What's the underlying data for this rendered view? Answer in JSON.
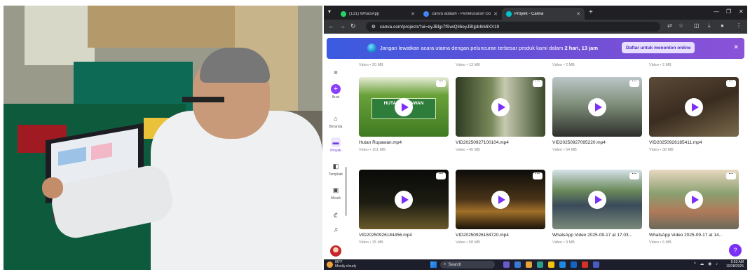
{
  "browser": {
    "tabs": [
      {
        "label": "(131) WhatsApp",
        "color": "#25d366"
      },
      {
        "label": "canva adalah - Penelusuran Go",
        "color": "#4285f4"
      },
      {
        "label": "Proyek - Canva",
        "color": "#00c4cc"
      }
    ],
    "url": "canva.com/projects?ui=eyJBIjp7fSwiQiI6eyJBIjpbIkMiXX19"
  },
  "banner": {
    "text_before": "Jangan lewatkan acara utama dengan peluncuran terbesar produk kami dalam ",
    "countdown": "2 hari, 13 jam",
    "button": "Daftar untuk menonton online",
    "close": "✕"
  },
  "sidebar": {
    "items": [
      {
        "label": "Buat",
        "icon": "plus-icon"
      },
      {
        "label": "Beranda",
        "icon": "home-icon"
      },
      {
        "label": "Proyek",
        "icon": "folder-icon"
      },
      {
        "label": "Template",
        "icon": "template-icon"
      },
      {
        "label": "Merek",
        "icon": "brand-icon"
      }
    ]
  },
  "top_row_meta": [
    "Video • 20 MB",
    "Video • 13 MB",
    "Video • 2 MB",
    "Video • 2 MB"
  ],
  "cards": [
    {
      "title": "Hutan Rupawan.mp4",
      "meta": "Video • 101 MB",
      "thumb_banner": "HUTAN RUPAWAN"
    },
    {
      "title": "VID20250927100104.mp4",
      "meta": "Video • 45 MB"
    },
    {
      "title": "VID20250927095220.mp4",
      "meta": "Video • 54 MB"
    },
    {
      "title": "VID20250926185411.mp4",
      "meta": "Video • 38 MB"
    },
    {
      "title": "VID20250926184456.mp4",
      "meta": "Video • 35 MB"
    },
    {
      "title": "VID20250926184720.mp4",
      "meta": "Video • 58 MB"
    },
    {
      "title": "WhatsApp Video 2025-09-17 at 17.03...",
      "meta": "Video • 9 MB"
    },
    {
      "title": "WhatsApp Video 2025-09-17 at 14...",
      "meta": "Video • 6 MB"
    }
  ],
  "taskbar": {
    "weather_temp": "86°F",
    "weather_desc": "Mostly cloudy",
    "search": "Search",
    "time": "9:53 AM",
    "date": "10/28/2025"
  },
  "help": "?"
}
